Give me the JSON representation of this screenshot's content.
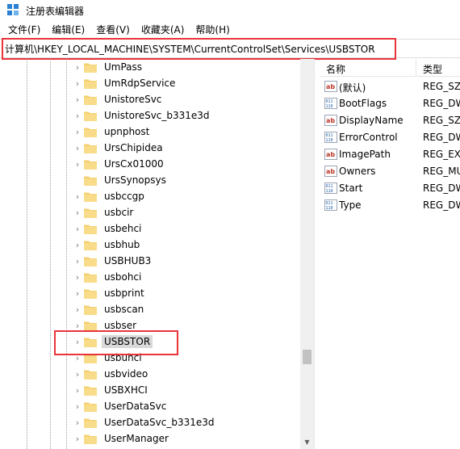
{
  "window": {
    "title": "注册表编辑器",
    "icon": "registry-editor-icon"
  },
  "menu": [
    {
      "label": "文件(F)"
    },
    {
      "label": "编辑(E)"
    },
    {
      "label": "查看(V)"
    },
    {
      "label": "收藏夹(A)"
    },
    {
      "label": "帮助(H)"
    }
  ],
  "address": {
    "value": "计算机\\HKEY_LOCAL_MACHINE\\SYSTEM\\CurrentControlSet\\Services\\USBSTOR"
  },
  "tree": {
    "items": [
      {
        "label": "UmPass",
        "expandable": true
      },
      {
        "label": "UmRdpService",
        "expandable": true
      },
      {
        "label": "UnistoreSvc",
        "expandable": true
      },
      {
        "label": "UnistoreSvc_b331e3d",
        "expandable": true
      },
      {
        "label": "upnphost",
        "expandable": true
      },
      {
        "label": "UrsChipidea",
        "expandable": true
      },
      {
        "label": "UrsCx01000",
        "expandable": true
      },
      {
        "label": "UrsSynopsys",
        "expandable": false
      },
      {
        "label": "usbccgp",
        "expandable": true
      },
      {
        "label": "usbcir",
        "expandable": true
      },
      {
        "label": "usbehci",
        "expandable": true
      },
      {
        "label": "usbhub",
        "expandable": true
      },
      {
        "label": "USBHUB3",
        "expandable": true
      },
      {
        "label": "usbohci",
        "expandable": true
      },
      {
        "label": "usbprint",
        "expandable": true
      },
      {
        "label": "usbscan",
        "expandable": true
      },
      {
        "label": "usbser",
        "expandable": true
      },
      {
        "label": "USBSTOR",
        "expandable": true,
        "selected": true
      },
      {
        "label": "usbuhci",
        "expandable": true
      },
      {
        "label": "usbvideo",
        "expandable": true
      },
      {
        "label": "USBXHCI",
        "expandable": true
      },
      {
        "label": "UserDataSvc",
        "expandable": true
      },
      {
        "label": "UserDataSvc_b331e3d",
        "expandable": true
      },
      {
        "label": "UserManager",
        "expandable": true
      }
    ]
  },
  "values": {
    "headers": {
      "name": "名称",
      "type": "类型"
    },
    "rows": [
      {
        "name": "(默认)",
        "type": "REG_SZ",
        "icon": "string-value-icon"
      },
      {
        "name": "BootFlags",
        "type": "REG_DW",
        "icon": "binary-value-icon"
      },
      {
        "name": "DisplayName",
        "type": "REG_SZ",
        "icon": "string-value-icon"
      },
      {
        "name": "ErrorControl",
        "type": "REG_DW",
        "icon": "binary-value-icon"
      },
      {
        "name": "ImagePath",
        "type": "REG_EXI",
        "icon": "string-value-icon"
      },
      {
        "name": "Owners",
        "type": "REG_MU",
        "icon": "string-value-icon"
      },
      {
        "name": "Start",
        "type": "REG_DW",
        "icon": "binary-value-icon"
      },
      {
        "name": "Type",
        "type": "REG_DW",
        "icon": "binary-value-icon"
      }
    ]
  },
  "colors": {
    "annotation": "#e8343a",
    "folder": "#f4d06f",
    "selection": "#d9d9d9"
  }
}
